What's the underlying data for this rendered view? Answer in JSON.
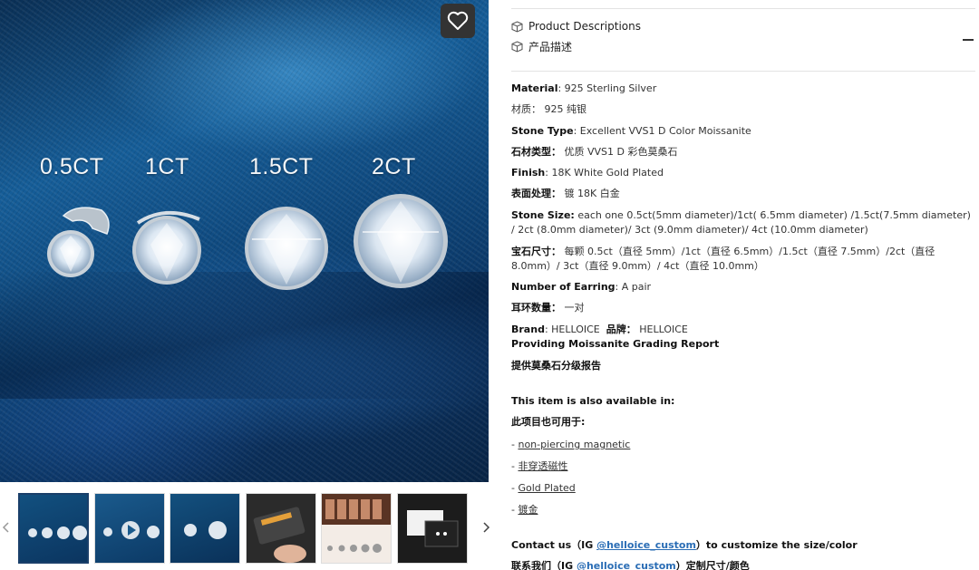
{
  "gallery": {
    "sizes": [
      "0.5CT",
      "1CT",
      "1.5CT",
      "2CT"
    ],
    "wishlist_icon": "heart-icon",
    "thumbnails": [
      {
        "name": "thumb-sizes",
        "active": true
      },
      {
        "name": "thumb-video",
        "active": false
      },
      {
        "name": "thumb-side",
        "active": false
      },
      {
        "name": "thumb-tester",
        "active": false
      },
      {
        "name": "thumb-ear-chart",
        "active": false
      },
      {
        "name": "thumb-box",
        "active": false
      }
    ],
    "prev_icon": "chevron-left-icon",
    "next_icon": "chevron-right-icon"
  },
  "accordion": {
    "title_en": "Product Descriptions",
    "title_zh": "产品描述",
    "icon": "box-icon",
    "toggle_icon": "minus-icon"
  },
  "specs": {
    "material_label": "Material",
    "material_value": ": 925 Sterling Silver",
    "material_zh": "材质： 925 纯银",
    "stone_label": "Stone Type",
    "stone_value": ": Excellent VVS1 D Color Moissanite",
    "stone_zh_label": "石材类型：",
    "stone_zh_value": " 优质 VVS1 D 彩色莫桑石",
    "finish_label": "Finish",
    "finish_value": ": 18K White Gold Plated",
    "finish_zh_label": "表面处理：",
    "finish_zh_value": " 镀 18K 白金",
    "size_label": "Stone Size:",
    "size_value": " each one 0.5ct(5mm diameter)/1ct( 6.5mm diameter) /1.5ct(7.5mm diameter) / 2ct (8.0mm diameter)/ 3ct (9.0mm diameter)/ 4ct (10.0mm diameter)",
    "size_zh_label": "宝石尺寸：",
    "size_zh_value": " 每颗 0.5ct（直径 5mm）/1ct（直径 6.5mm）/1.5ct（直径 7.5mm）/2ct（直径 8.0mm）/ 3ct（直径 9.0mm）/ 4ct（直径 10.0mm）",
    "earring_label": "Number of Earring",
    "earring_value": ": A pair",
    "earring_zh_label": "耳环数量：",
    "earring_zh_value": " 一对",
    "brand_label": "Brand",
    "brand_value": ": HELLOICE",
    "brand_zh_label": "品牌：",
    "brand_zh_value": " HELLOICE",
    "report_en": "Providing Moissanite Grading Report",
    "report_zh": "提供莫桑石分级报告"
  },
  "availability": {
    "heading_en": "This item is also available in:",
    "heading_zh": "此项目也可用于:",
    "options": [
      {
        "dash": "- ",
        "label": "non-piercing magnetic"
      },
      {
        "dash": "- ",
        "label": "非穿透磁性"
      },
      {
        "dash": "- ",
        "label": "Gold Plated"
      },
      {
        "dash": "- ",
        "label": "镀金"
      }
    ]
  },
  "contact": {
    "en_prefix": "Contact us（IG ",
    "handle": "@helloice_custom",
    "en_suffix": "）to customize the size/color",
    "zh_prefix": "联系我们（IG ",
    "zh_handle": "@helloice_custom",
    "zh_suffix": "）定制尺寸/颜色"
  }
}
